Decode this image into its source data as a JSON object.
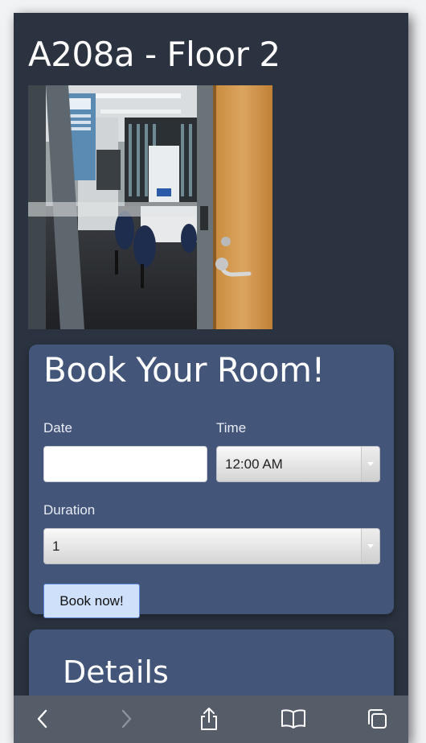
{
  "room": {
    "title": "A208a - Floor 2",
    "photo_icon": "room-photo"
  },
  "booking": {
    "heading": "Book Your Room!",
    "date_label": "Date",
    "date_value": "",
    "time_label": "Time",
    "time_value": "12:00 AM",
    "duration_label": "Duration",
    "duration_value": "1",
    "submit_label": "Book now!"
  },
  "details": {
    "heading": "Details"
  },
  "toolbar": {
    "items": [
      {
        "name": "back",
        "icon": "chevron-left-icon"
      },
      {
        "name": "forward",
        "icon": "chevron-right-icon"
      },
      {
        "name": "share",
        "icon": "share-icon"
      },
      {
        "name": "bookmarks",
        "icon": "book-icon"
      },
      {
        "name": "tabs",
        "icon": "tabs-icon"
      }
    ]
  },
  "colors": {
    "page_background": "#2b3340",
    "card_background": "#435579",
    "toolbar_background": "#555d69",
    "button_background": "#cfe0fb"
  }
}
